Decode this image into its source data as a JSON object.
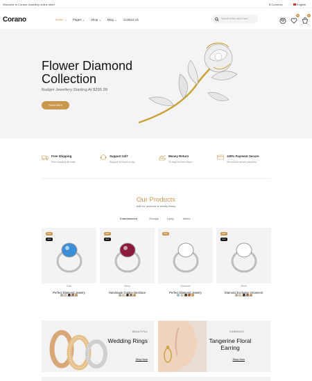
{
  "topbar": {
    "welcome": "Welcome to Corano Jewellery online store",
    "currency": "$ Currency",
    "language": "English"
  },
  "header": {
    "logo": "Corano",
    "nav": [
      "Home",
      "Pages",
      "Shop",
      "Blog",
      "Contact Us"
    ],
    "search_placeholder": "Search entire store here",
    "wishlist_count": "0",
    "cart_count": "3"
  },
  "hero": {
    "title": "Flower Diamond Collection",
    "subtitle": "Budget Jewellery Starting At $295.99",
    "button": "Read More"
  },
  "features": [
    {
      "title": "Free Shipping",
      "desc": "Free shipping all order",
      "icon": "truck-icon"
    },
    {
      "title": "Support 24/7",
      "desc": "Support 24 hours a day",
      "icon": "support-icon"
    },
    {
      "title": "Money Return",
      "desc": "30 days for free return",
      "icon": "money-icon"
    },
    {
      "title": "100% Payment Secure",
      "desc": "We ensure secure payment",
      "icon": "card-icon"
    }
  ],
  "products_section": {
    "title": "Our Products",
    "subtitle": "Add our products to weekly lineup",
    "tabs": [
      "Entertainment",
      "Storage",
      "Lying",
      "Tables"
    ]
  },
  "products": [
    {
      "category": "Gold",
      "name": "Perfect Diamond Jewelry",
      "price": "$60.00",
      "old_price": "$70.00",
      "labels": [
        "sale",
        "new"
      ],
      "gem": "#3c8ed8"
    },
    {
      "category": "Mony",
      "name": "Handmade Golden Necklace",
      "price": "$50.00",
      "old_price": "$80.00",
      "labels": [
        "sale",
        "new"
      ],
      "gem": "#8a1b3a"
    },
    {
      "category": "Diamond",
      "name": "Perfect Diamond Jewelry",
      "price": "$99.00",
      "old_price": "",
      "labels": [
        "sale"
      ],
      "gem": ""
    },
    {
      "category": "Silver",
      "name": "Diamond Exclusive Ornament",
      "price": "$55.00",
      "old_price": "$75.00",
      "labels": [
        "sale",
        "new"
      ],
      "gem": ""
    }
  ],
  "swatch_colors": [
    "#9bb8c9",
    "#cfcfcf",
    "#2b2b2b",
    "#a0522d",
    "#c9974d"
  ],
  "banners": [
    {
      "small": "BEAUTIFUL",
      "title": "Wedding Rings",
      "link": "Shop Now"
    },
    {
      "small": "EARRINGS",
      "title": "Tangerine Floral Earring",
      "link": "Shop Now"
    }
  ],
  "accent_color": "#c9974d"
}
